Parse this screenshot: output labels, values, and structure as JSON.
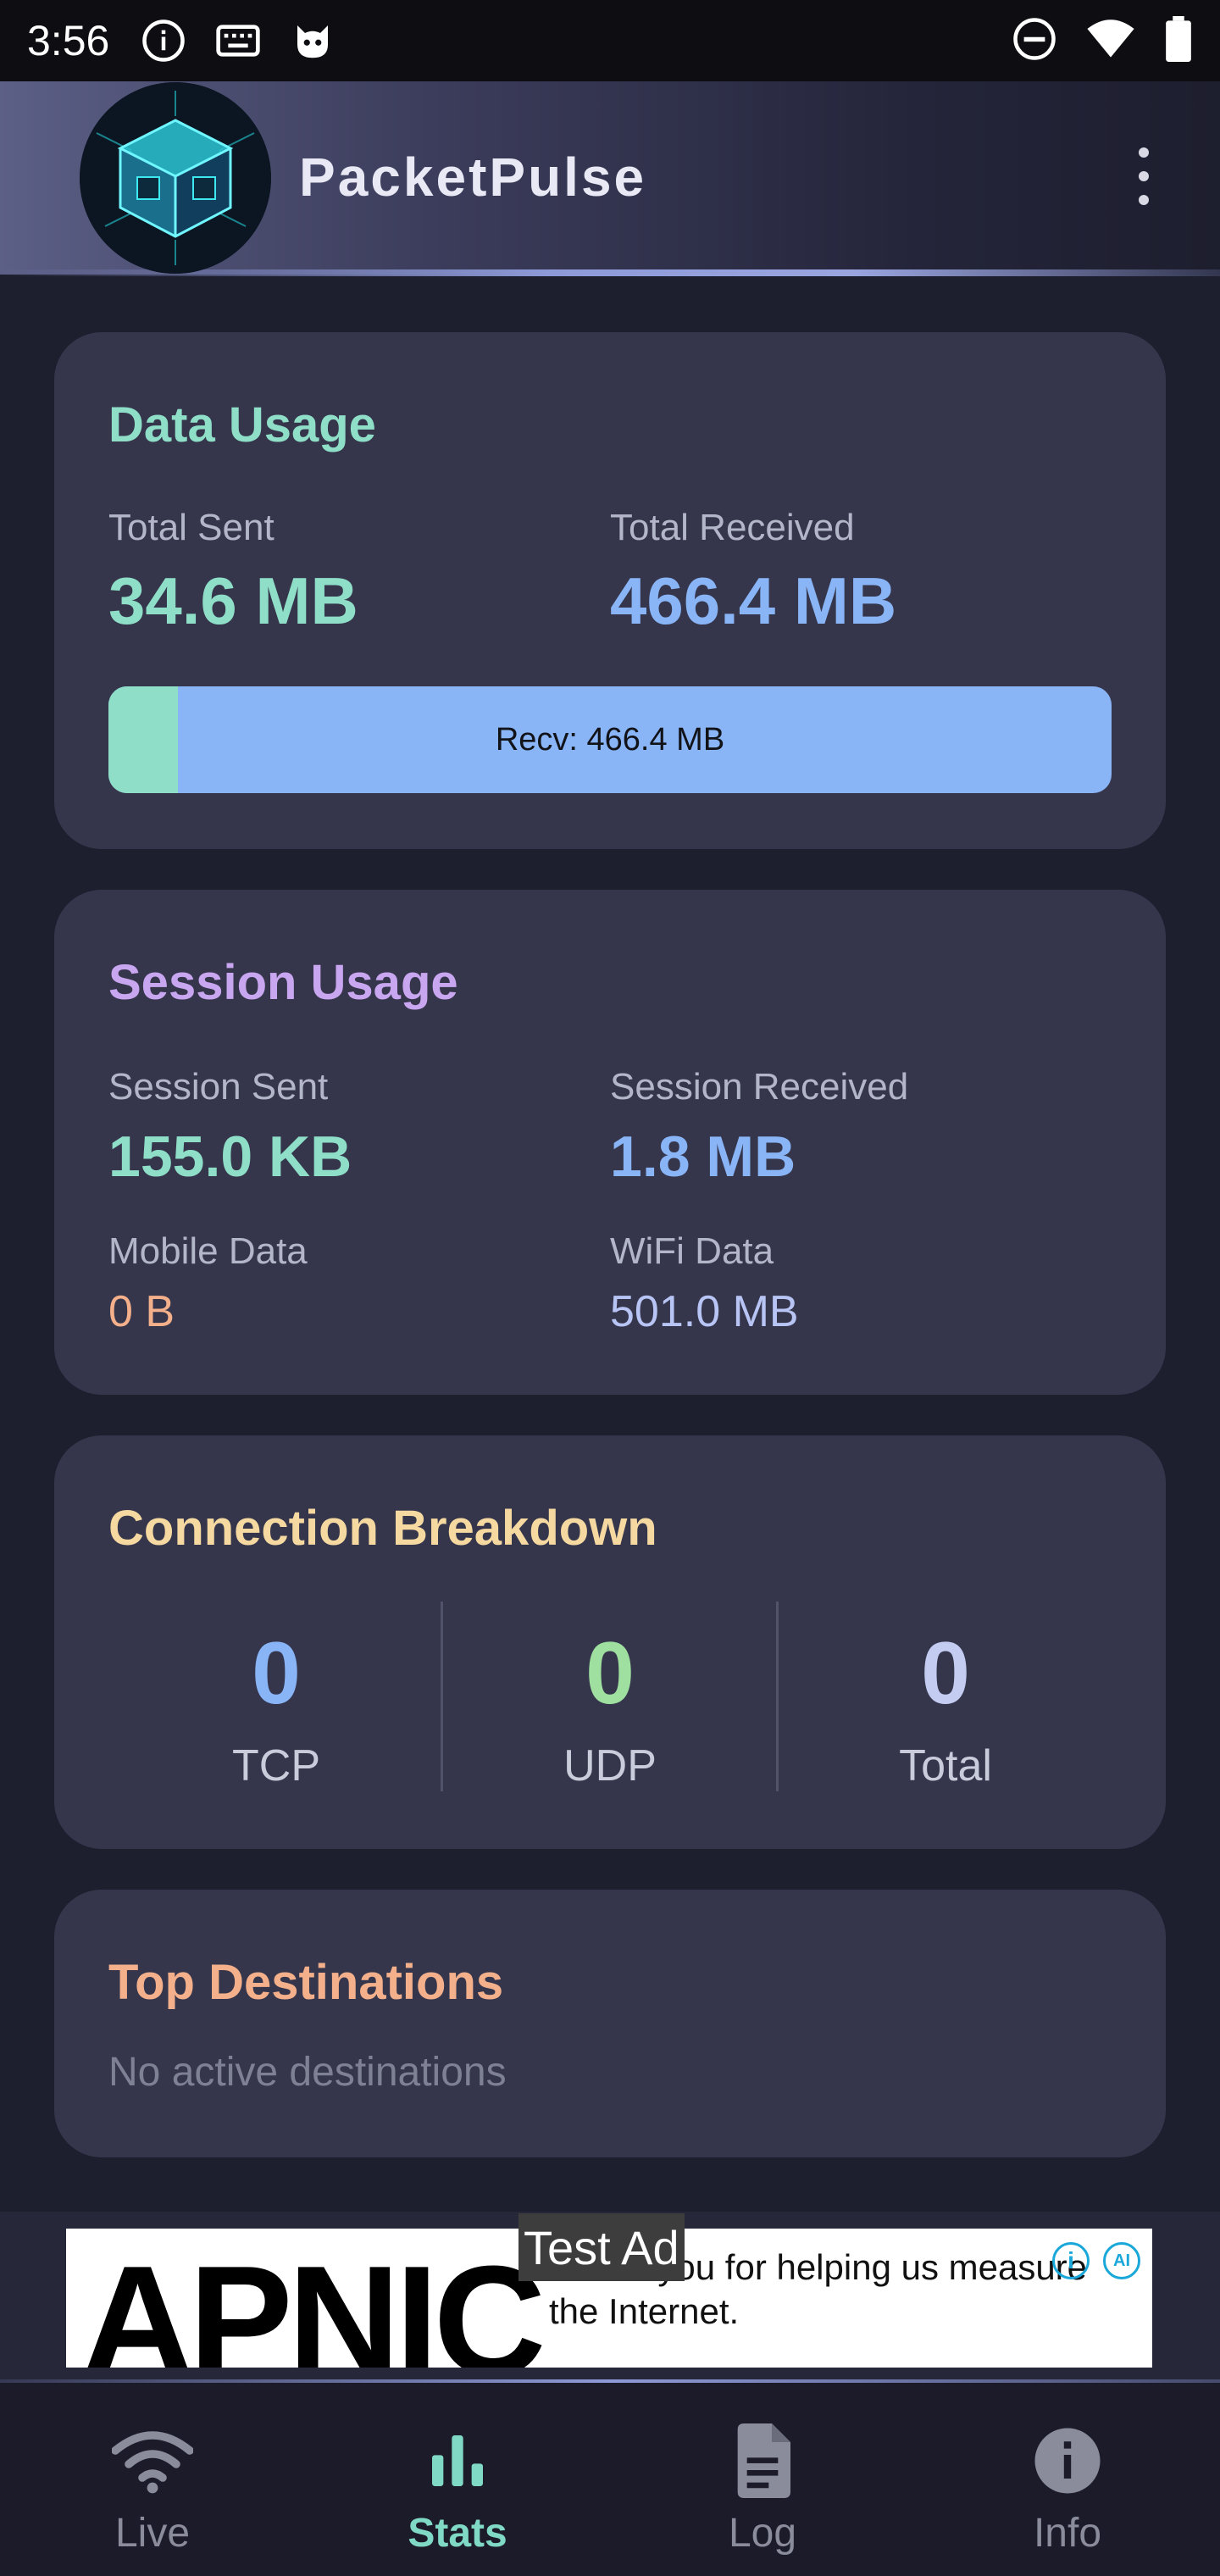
{
  "status_bar": {
    "time": "3:56"
  },
  "app_bar": {
    "title": "PacketPulse"
  },
  "data_usage": {
    "title": "Data Usage",
    "total_sent_label": "Total Sent",
    "total_sent_value": "34.6 MB",
    "total_received_label": "Total Received",
    "total_received_value": "466.4 MB",
    "bar_text": "Recv: 466.4 MB",
    "sent_fraction": 0.069
  },
  "session_usage": {
    "title": "Session Usage",
    "session_sent_label": "Session Sent",
    "session_sent_value": "155.0 KB",
    "session_received_label": "Session Received",
    "session_received_value": "1.8 MB",
    "mobile_label": "Mobile Data",
    "mobile_value": "0 B",
    "wifi_label": "WiFi Data",
    "wifi_value": "501.0 MB"
  },
  "connections": {
    "title": "Connection Breakdown",
    "items": [
      {
        "value": "0",
        "label": "TCP"
      },
      {
        "value": "0",
        "label": "UDP"
      },
      {
        "value": "0",
        "label": "Total"
      }
    ]
  },
  "destinations": {
    "title": "Top Destinations",
    "empty_text": "No active destinations"
  },
  "ad": {
    "badge": "Test Ad",
    "logo_text": "APNIC",
    "text": "Thank you for helping us measure the Internet."
  },
  "bottom_nav": {
    "items": [
      {
        "label": "Live",
        "icon": "wifi-icon"
      },
      {
        "label": "Stats",
        "icon": "bar-chart-icon"
      },
      {
        "label": "Log",
        "icon": "document-icon"
      },
      {
        "label": "Info",
        "icon": "info-icon"
      }
    ],
    "active": "Stats"
  },
  "colors": {
    "accent_teal": "#8fdfc8",
    "accent_blue": "#89b4f6",
    "accent_purple": "#c9a6f0",
    "accent_yellow": "#f5d9a1",
    "accent_orange": "#f4b08a",
    "card_bg": "#35364c",
    "screen_bg": "#1e1f2e"
  }
}
